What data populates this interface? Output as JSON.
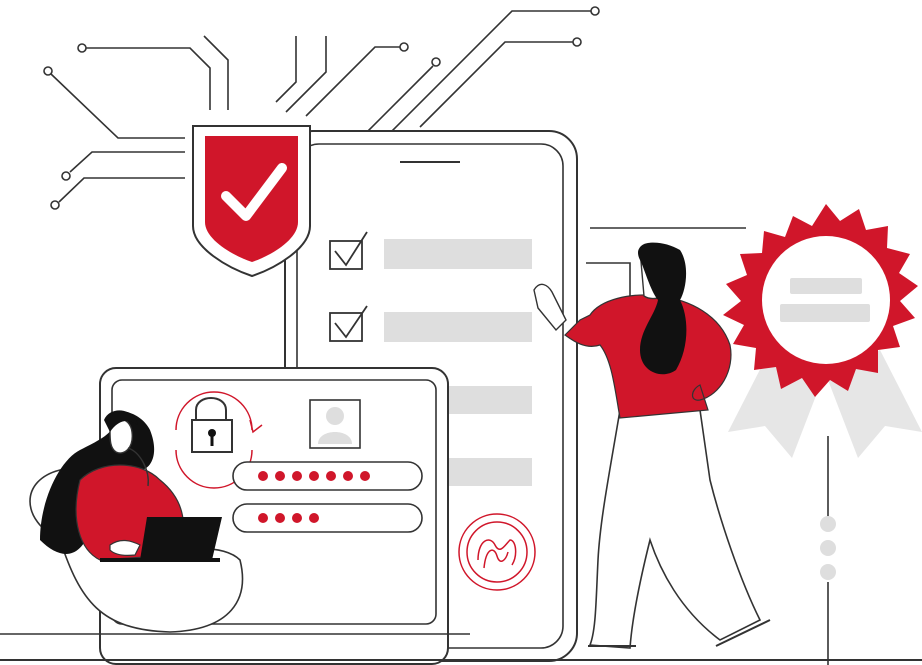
{
  "illustration": {
    "theme": "security-verification",
    "colors": {
      "accent": "#d0162a",
      "line": "#333333",
      "placeholder": "#dedede",
      "badge_ribbon": "#e6e6e6",
      "background": "#ffffff",
      "laptop": "#111111"
    },
    "checklist": {
      "checked_items": 2,
      "unchecked_items": 2
    },
    "password_fields": [
      {
        "dots": 7
      },
      {
        "dots": 4
      }
    ],
    "icons": [
      "shield-check-icon",
      "padlock-refresh-icon",
      "user-avatar-icon",
      "fingerprint-icon",
      "award-badge-icon"
    ]
  }
}
